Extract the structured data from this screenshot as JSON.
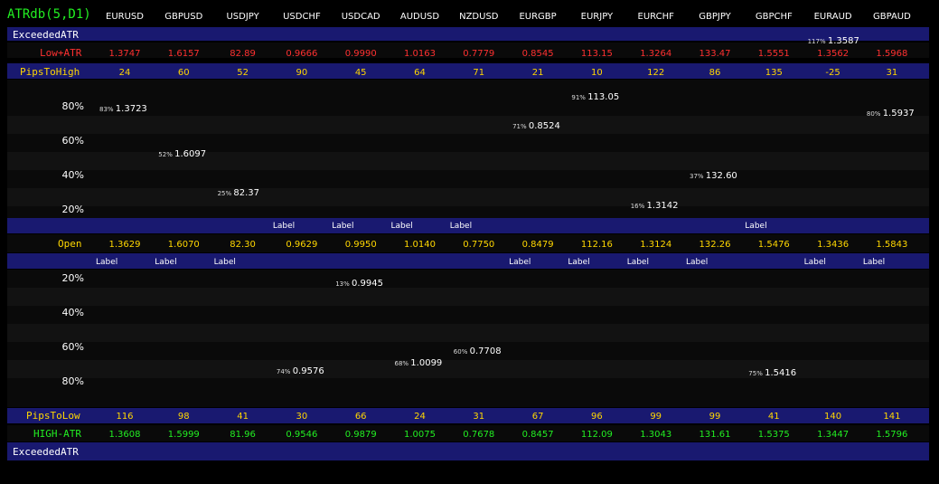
{
  "title": "ATRdb(5,D1)",
  "symbols": [
    "EURUSD",
    "GBPUSD",
    "USDJPY",
    "USDCHF",
    "USDCAD",
    "AUDUSD",
    "NZDUSD",
    "EURGBP",
    "EURJPY",
    "EURCHF",
    "GBPJPY",
    "GBPCHF",
    "EURAUD",
    "GBPAUD"
  ],
  "rows": {
    "exceeded_top": {
      "label": "ExceededATR"
    },
    "low_atr": {
      "label": "Low+ATR",
      "values": [
        "1.3747",
        "1.6157",
        "82.89",
        "0.9666",
        "0.9990",
        "1.0163",
        "0.7779",
        "0.8545",
        "113.15",
        "1.3264",
        "133.47",
        "1.5551",
        "1.3562",
        "1.5968"
      ]
    },
    "pips_to_high": {
      "label": "PipsToHigh",
      "values": [
        "24",
        "60",
        "52",
        "90",
        "45",
        "64",
        "71",
        "21",
        "10",
        "122",
        "86",
        "135",
        "-25",
        "31"
      ]
    },
    "open": {
      "label": "Open",
      "values": [
        "1.3629",
        "1.6070",
        "82.30",
        "0.9629",
        "0.9950",
        "1.0140",
        "0.7750",
        "0.8479",
        "112.16",
        "1.3124",
        "132.26",
        "1.5476",
        "1.3436",
        "1.5843"
      ]
    },
    "pips_to_low": {
      "label": "PipsToLow",
      "values": [
        "116",
        "98",
        "41",
        "30",
        "66",
        "24",
        "31",
        "67",
        "96",
        "99",
        "99",
        "41",
        "140",
        "141"
      ]
    },
    "high_atr": {
      "label": "HIGH-ATR",
      "values": [
        "1.3608",
        "1.5999",
        "81.96",
        "0.9546",
        "0.9879",
        "1.0075",
        "0.7678",
        "0.8457",
        "112.09",
        "1.3043",
        "131.61",
        "1.5375",
        "1.3447",
        "1.5796"
      ]
    },
    "exceeded_bottom": {
      "label": "ExceededATR"
    }
  },
  "percent_labels_top": [
    "80%",
    "60%",
    "40%",
    "20%"
  ],
  "percent_labels_bottom": [
    "20%",
    "40%",
    "60%",
    "80%"
  ],
  "high_markers": [
    {
      "col": 0,
      "pct": "83%",
      "value": "1.3723"
    },
    {
      "col": 1,
      "pct": "52%",
      "value": "1.6097"
    },
    {
      "col": 2,
      "pct": "25%",
      "value": "82.37"
    },
    {
      "col": 7,
      "pct": "71%",
      "value": "0.8524"
    },
    {
      "col": 8,
      "pct": "91%",
      "value": "113.05"
    },
    {
      "col": 9,
      "pct": "16%",
      "value": "1.3142"
    },
    {
      "col": 10,
      "pct": "37%",
      "value": "132.60"
    },
    {
      "col": 12,
      "pct": "117%",
      "value": "1.3587"
    },
    {
      "col": 13,
      "pct": "80%",
      "value": "1.5937"
    }
  ],
  "low_markers": [
    {
      "col": 3,
      "pct": "74%",
      "value": "0.9576"
    },
    {
      "col": 4,
      "pct": "13%",
      "value": "0.9945"
    },
    {
      "col": 5,
      "pct": "68%",
      "value": "1.0099"
    },
    {
      "col": 6,
      "pct": "60%",
      "value": "0.7708"
    },
    {
      "col": 11,
      "pct": "75%",
      "value": "1.5416"
    }
  ],
  "placeholder_label": "Label"
}
